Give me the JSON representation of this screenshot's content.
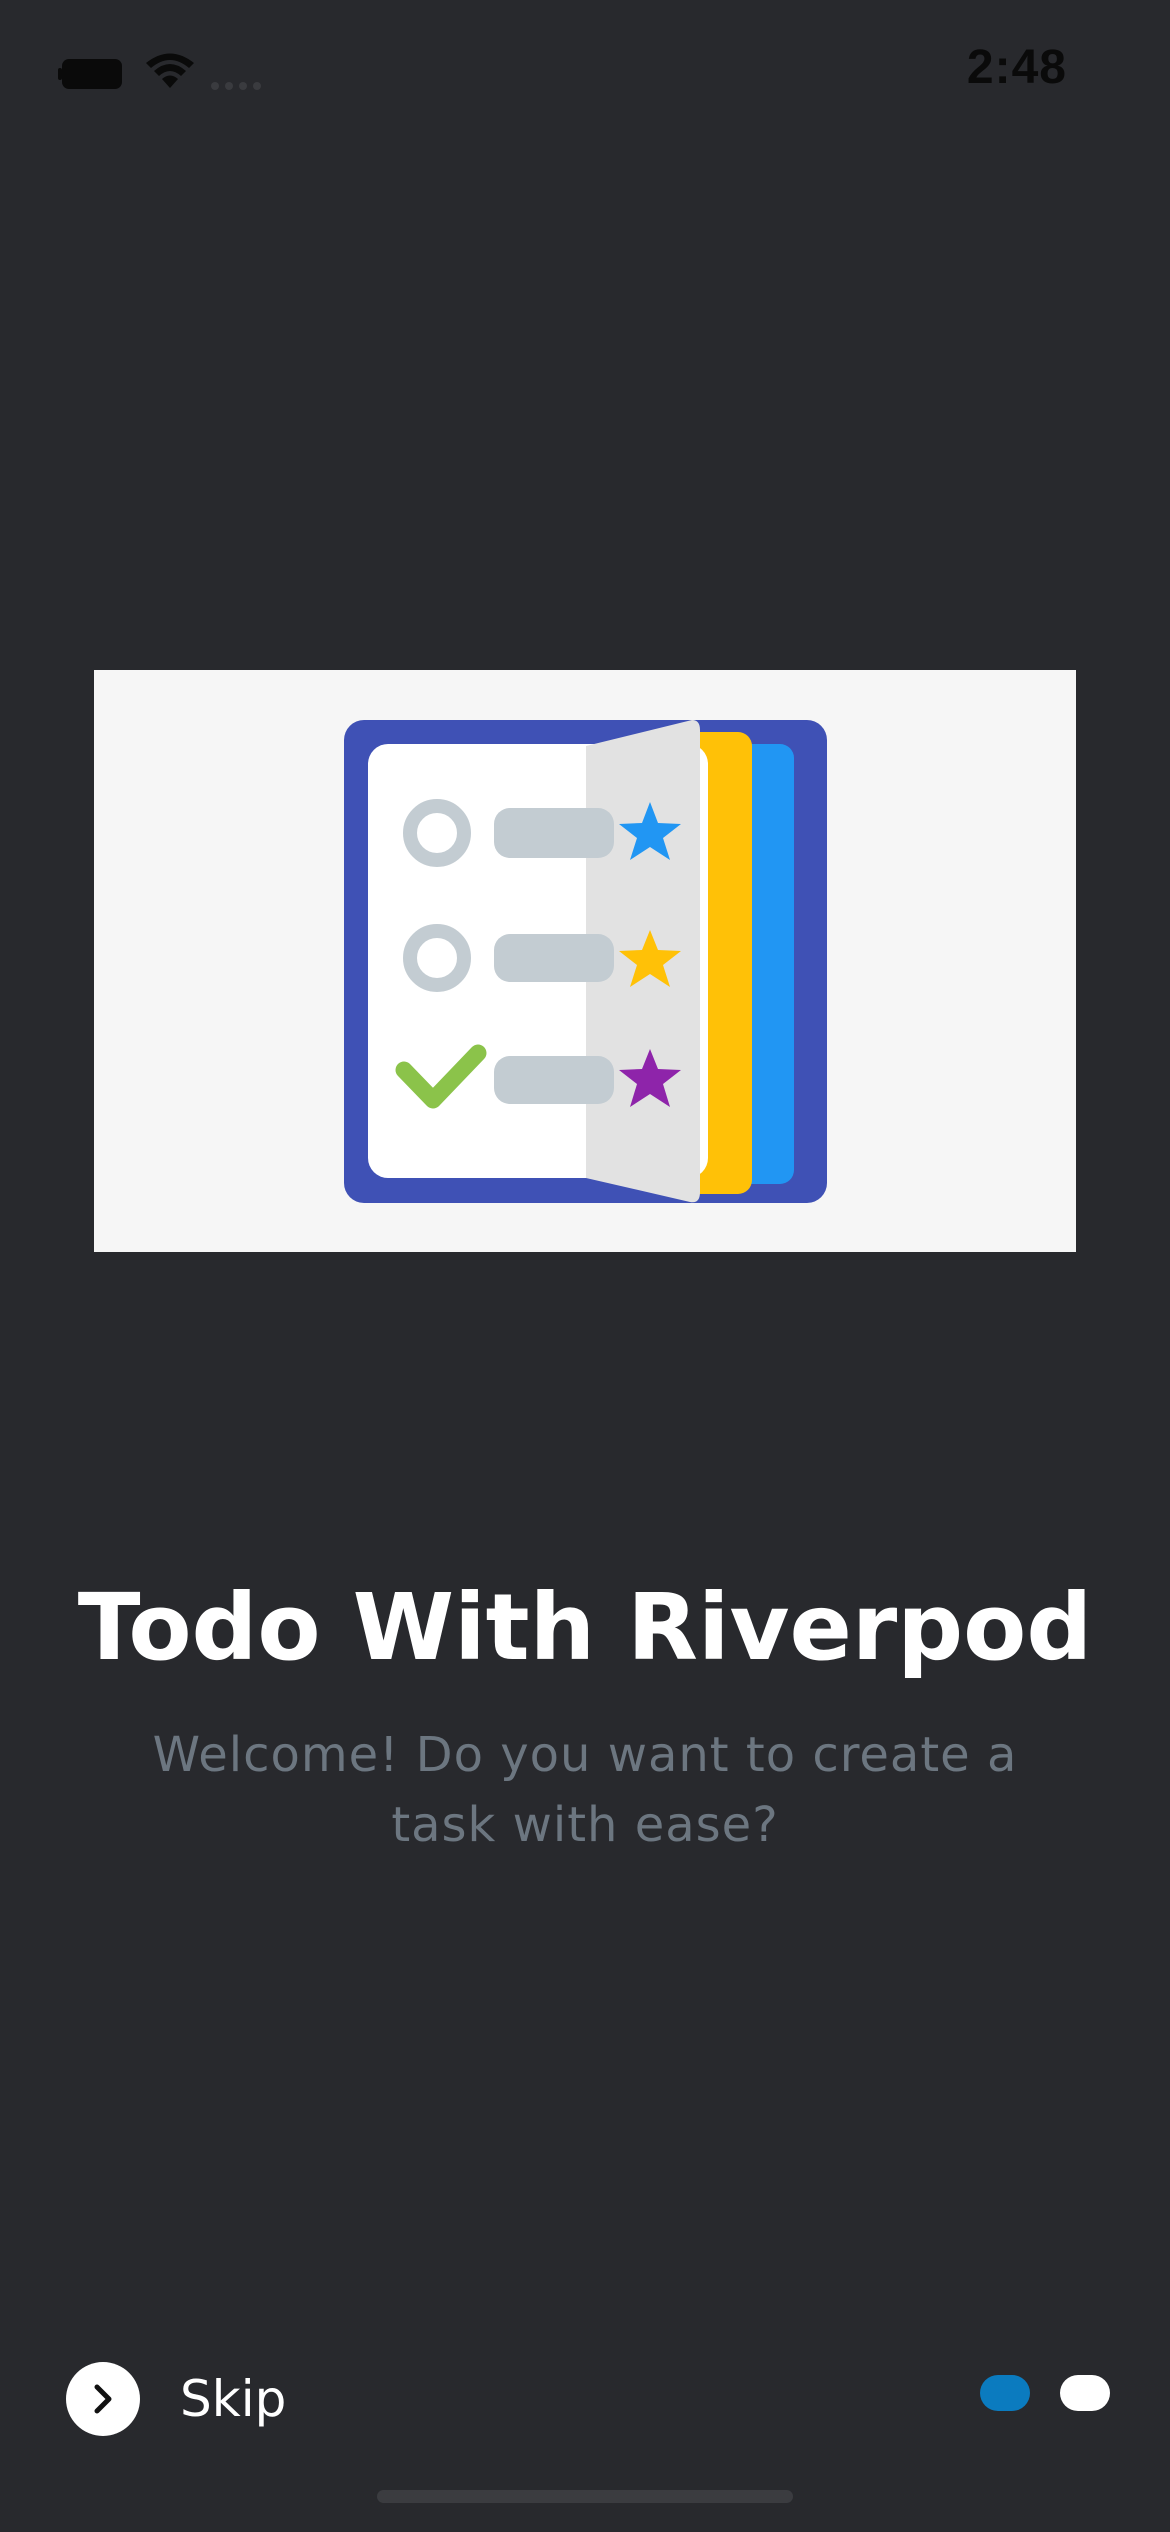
{
  "status_bar": {
    "time": "2:48",
    "icons": [
      "battery-icon",
      "wifi-icon",
      "signal-icon"
    ]
  },
  "onboarding": {
    "illustration": "todo-list-book-illustration",
    "title": "Todo With Riverpod",
    "subtitle": "Welcome! Do you want to create a task with ease?"
  },
  "controls": {
    "skip_label": "Skip",
    "skip_icon": "chevron-right-icon",
    "page_count": 2,
    "active_page": 1
  },
  "colors": {
    "background": "#28292d",
    "accent": "#0b7bbf",
    "title": "#ffffff",
    "subtitle": "#6c7680",
    "book_cover": "#3f51b5",
    "blue_star": "#2196f3",
    "yellow_star": "#ffc107",
    "purple_star": "#8e24aa",
    "check": "#8bc34a"
  }
}
